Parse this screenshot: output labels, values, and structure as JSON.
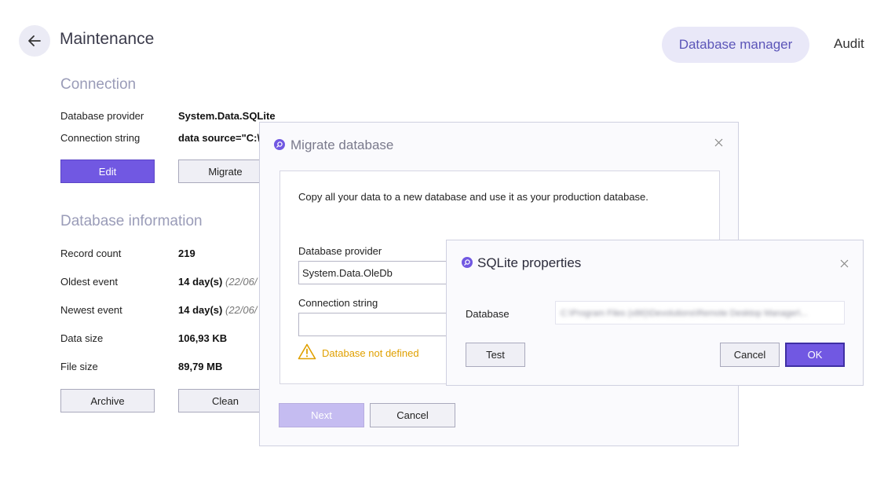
{
  "header": {
    "title": "Maintenance",
    "nav": {
      "database_manager": "Database manager",
      "audit": "Audit"
    }
  },
  "connection": {
    "section_title": "Connection",
    "provider_label": "Database provider",
    "provider_value": "System.Data.SQLite",
    "conn_label": "Connection string",
    "conn_value": "data source=\"C:\\",
    "edit_button": "Edit",
    "migrate_button": "Migrate"
  },
  "db_info": {
    "section_title": "Database information",
    "rows": [
      {
        "label": "Record count",
        "value": "219",
        "extra": ""
      },
      {
        "label": "Oldest event",
        "value": "14 day(s)",
        "extra": "(22/06/"
      },
      {
        "label": "Newest event",
        "value": "14 day(s)",
        "extra": "(22/06/"
      },
      {
        "label": "Data size",
        "value": "106,93 KB",
        "extra": ""
      },
      {
        "label": "File size",
        "value": "89,79 MB",
        "extra": ""
      }
    ],
    "archive_button": "Archive",
    "clean_button": "Clean"
  },
  "migrate_dialog": {
    "title": "Migrate database",
    "description": "Copy all your data to a new database and use it as your production database.",
    "provider_label": "Database provider",
    "provider_value": "System.Data.OleDb",
    "conn_label": "Connection string",
    "conn_value": "",
    "warning": "Database not defined",
    "next_button": "Next",
    "cancel_button": "Cancel"
  },
  "sqlite_dialog": {
    "title": "SQLite properties",
    "database_label": "Database",
    "database_value": "C:\\Program Files (x86)\\Devolutions\\Remote Desktop Manager\\...",
    "test_button": "Test",
    "cancel_button": "Cancel",
    "ok_button": "OK"
  },
  "colors": {
    "accent": "#7158e2",
    "warning": "#e0a000",
    "section_title": "#9a9cb8"
  },
  "icons": {
    "back": "arrow-left-icon",
    "dialog": "search-icon",
    "close": "close-icon",
    "warning": "warning-triangle-icon"
  }
}
